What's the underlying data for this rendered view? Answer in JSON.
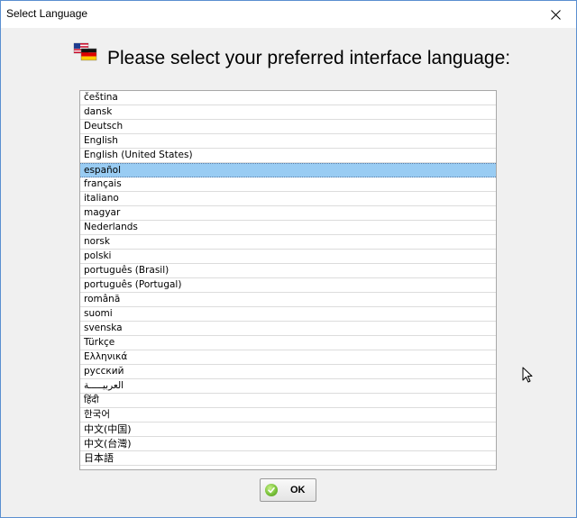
{
  "window": {
    "title": "Select Language"
  },
  "prompt": "Please select your preferred interface language:",
  "languages": [
    "čeština",
    "dansk",
    "Deutsch",
    "English",
    "English (United States)",
    "español",
    "français",
    "italiano",
    "magyar",
    "Nederlands",
    "norsk",
    "polski",
    "português (Brasil)",
    "português (Portugal)",
    "română",
    "suomi",
    "svenska",
    "Türkçe",
    "Ελληνικά",
    "русский",
    "العربيـــــة",
    "हिंदी",
    "한국어",
    "中文(中国)",
    "中文(台灣)",
    "日本語"
  ],
  "selected_index": 5,
  "ok_button": {
    "label": "OK",
    "icon": "checkmark-icon"
  },
  "colors": {
    "selection": "#99ccf3",
    "window_border": "#5a8fd0"
  }
}
